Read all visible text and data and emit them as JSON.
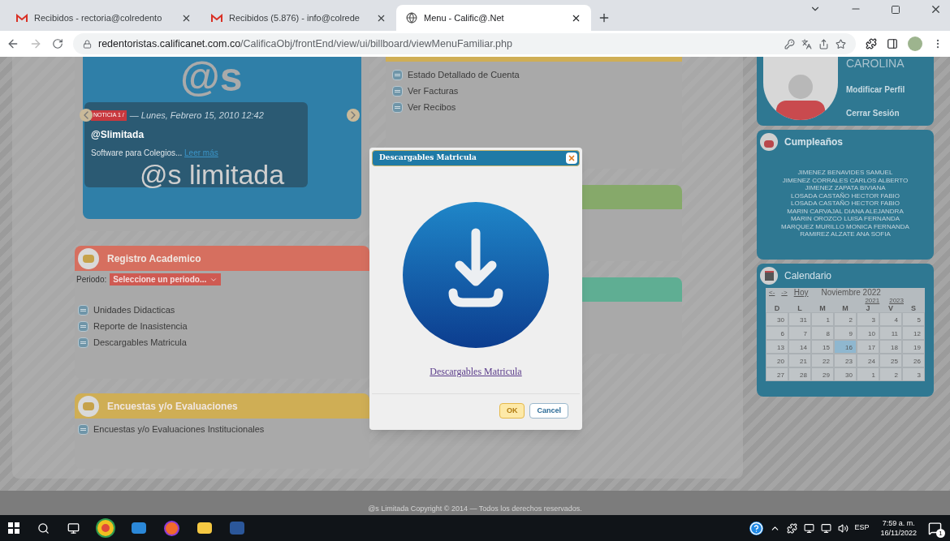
{
  "browser": {
    "tabs": [
      {
        "title": "Recibidos - rectoria@colredento",
        "kind": "mail",
        "selected": false
      },
      {
        "title": "Recibidos (5.876) - info@colrede",
        "kind": "mail",
        "selected": false
      },
      {
        "title": "Menu - Calific@.Net",
        "kind": "globe",
        "selected": true
      }
    ],
    "url_host": "redentoristas.calificanet.com.co",
    "url_path": "/CalificaObj/frontEnd/view/ui/billboard/viewMenuFamiliar.php"
  },
  "slider": {
    "logo_mark": "@s",
    "badge": "NOTICIA 1 /",
    "date": "— Lunes, Febrero 15, 2010 12:42",
    "title": "@Slimitada",
    "text": "Software para Colegios...",
    "link": "Leer más",
    "logo_text": "@s limitada"
  },
  "left_sections": [
    {
      "title": "Registro Academico",
      "color": "#d66f5f",
      "period_label": "Periodo:",
      "period_select": "Seleccione un periodo...",
      "items": [
        "Unidades Didacticas",
        "Reporte de Inasistencia",
        "Descargables Matricula"
      ]
    },
    {
      "title": "Encuestas y/o Evaluaciones",
      "color": "#cfae55",
      "items": [
        "Encuestas y/o Evaluaciones Institucionales"
      ]
    }
  ],
  "middle_sections": [
    {
      "color": "#cfae55",
      "items": [
        "Estado Detallado de Cuenta",
        "Ver Facturas",
        "Ver Recibos"
      ]
    },
    {
      "color": "#86a96a"
    },
    {
      "color": "#5fae93"
    }
  ],
  "profile": {
    "name": "CAROLINA",
    "links": [
      "Modificar Perfil",
      "Cerrar Sesión"
    ]
  },
  "birthdays": {
    "title": "Cumpleaños",
    "names": [
      "JIMENEZ BENAVIDES SAMUEL",
      "JIMENEZ CORRALES CARLOS ALBERTO",
      "JIMENEZ ZAPATA BIVIANA",
      "LOSADA CASTAÑO HECTOR FABIO",
      "LOSADA CASTAÑO HECTOR FABIO",
      "MARIN CARVAJAL DIANA ALEJANDRA",
      "MARIN OROZCO LUISA FERNANDA",
      "MARQUEZ MURILLO MONICA FERNANDA",
      "RAMIREZ ALZATE ANA SOFIA"
    ]
  },
  "calendar": {
    "title": "Calendario",
    "prev": "<-",
    "next": "->",
    "today_link": "Hoy",
    "month": "Noviembre 2022",
    "prev_year": "2021",
    "next_year": "2023",
    "weekdays": [
      "D",
      "L",
      "M",
      "M",
      "J",
      "V",
      "S"
    ],
    "weeks": [
      [
        {
          "d": "30",
          "selected": false
        },
        {
          "d": "31",
          "selected": false
        },
        {
          "d": "1",
          "selected": false
        },
        {
          "d": "2",
          "selected": false
        },
        {
          "d": "3",
          "selected": false
        },
        {
          "d": "4",
          "selected": false
        },
        {
          "d": "5",
          "selected": false
        }
      ],
      [
        {
          "d": "6",
          "selected": false
        },
        {
          "d": "7",
          "selected": false
        },
        {
          "d": "8",
          "selected": false
        },
        {
          "d": "9",
          "selected": false
        },
        {
          "d": "10",
          "selected": false
        },
        {
          "d": "11",
          "selected": false
        },
        {
          "d": "12",
          "selected": false
        }
      ],
      [
        {
          "d": "13",
          "selected": false
        },
        {
          "d": "14",
          "selected": false
        },
        {
          "d": "15",
          "selected": false
        },
        {
          "d": "16",
          "selected": true
        },
        {
          "d": "17",
          "selected": false
        },
        {
          "d": "18",
          "selected": false
        },
        {
          "d": "19",
          "selected": false
        }
      ],
      [
        {
          "d": "20",
          "selected": false
        },
        {
          "d": "21",
          "selected": false
        },
        {
          "d": "22",
          "selected": false
        },
        {
          "d": "23",
          "selected": false
        },
        {
          "d": "24",
          "selected": false
        },
        {
          "d": "25",
          "selected": false
        },
        {
          "d": "26",
          "selected": false
        }
      ],
      [
        {
          "d": "27",
          "selected": false
        },
        {
          "d": "28",
          "selected": false
        },
        {
          "d": "29",
          "selected": false
        },
        {
          "d": "30",
          "selected": false
        },
        {
          "d": "1",
          "selected": false
        },
        {
          "d": "2",
          "selected": false
        },
        {
          "d": "3",
          "selected": false
        }
      ]
    ]
  },
  "footer": "@s Limitada Copyright © 2014 — Todos los derechos reservados.",
  "modal": {
    "title": "Descargables Matricula",
    "link": "Descargables Matricula",
    "buttons": [
      {
        "label": "OK",
        "kind": "primary"
      },
      {
        "label": "Cancel",
        "kind": "secondary"
      }
    ]
  },
  "taskbar": {
    "lang": "ESP",
    "time": "7:59 a. m.",
    "date": "16/11/2022",
    "notifications": "1"
  }
}
